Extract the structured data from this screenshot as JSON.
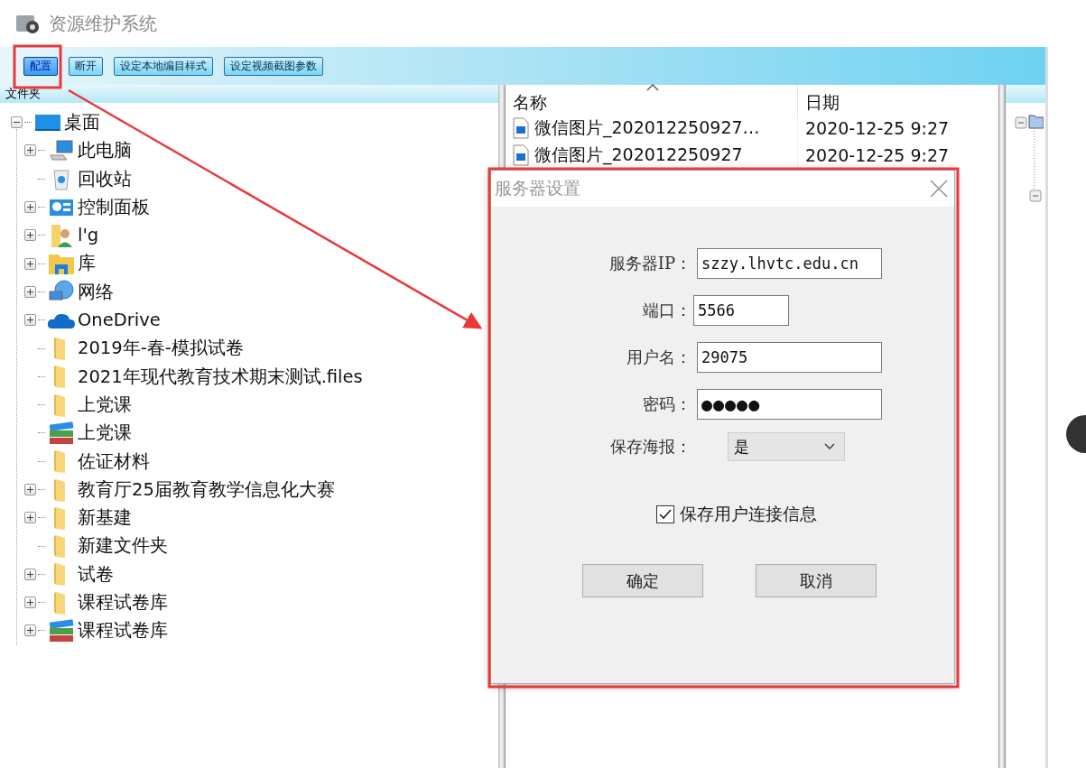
{
  "window": {
    "title": "资源维护系统"
  },
  "toolbar": [
    {
      "label": "配置",
      "selected": true
    },
    {
      "label": "断开",
      "selected": false
    },
    {
      "label": "设定本地编目样式",
      "selected": false
    },
    {
      "label": "设定视频截图参数",
      "selected": false
    }
  ],
  "folder_pane": {
    "title": "文件夹",
    "tree": [
      {
        "label": "桌面",
        "kind": "desktop",
        "expanded": true,
        "children": [
          {
            "label": "此电脑",
            "kind": "computer",
            "expanded": false
          },
          {
            "label": "回收站",
            "kind": "bin"
          },
          {
            "label": "控制面板",
            "kind": "panel",
            "expanded": false
          },
          {
            "label": "l'g",
            "kind": "user",
            "expanded": false
          },
          {
            "label": "库",
            "kind": "library",
            "expanded": false
          },
          {
            "label": "网络",
            "kind": "network",
            "expanded": false
          },
          {
            "label": "OneDrive",
            "kind": "cloud",
            "expanded": false
          },
          {
            "label": "2019年-春-模拟试卷",
            "kind": "folder"
          },
          {
            "label": "2021年现代教育技术期末测试.files",
            "kind": "folder"
          },
          {
            "label": "上党课",
            "kind": "folder"
          },
          {
            "label": "上党课",
            "kind": "archive"
          },
          {
            "label": "佐证材料",
            "kind": "folder"
          },
          {
            "label": "教育厅25届教育教学信息化大赛",
            "kind": "folder",
            "expanded": false
          },
          {
            "label": "新基建",
            "kind": "folder",
            "expanded": false
          },
          {
            "label": "新建文件夹",
            "kind": "folder"
          },
          {
            "label": "试卷",
            "kind": "folder",
            "expanded": false
          },
          {
            "label": "课程试卷库",
            "kind": "folder",
            "expanded": false
          },
          {
            "label": "课程试卷库",
            "kind": "archive",
            "expanded": false
          }
        ]
      }
    ]
  },
  "file_list": {
    "columns": [
      "名称",
      "日期"
    ],
    "rows": [
      {
        "name": "微信图片_202012250927…",
        "date": "2020-12-25 9:27"
      },
      {
        "name": "微信图片_202012250927",
        "date": "2020-12-25 9:27"
      }
    ]
  },
  "dialog": {
    "title": "服务器设置",
    "fields": [
      {
        "kind": "text",
        "label": "服务器IP：",
        "value": "szzy.lhvtc.edu.cn"
      },
      {
        "kind": "short",
        "label": "端口：",
        "value": "5566"
      },
      {
        "kind": "text",
        "label": "用户名：",
        "value": "29075"
      },
      {
        "kind": "password",
        "label": "密码：",
        "value": "●●●●●"
      },
      {
        "kind": "select",
        "label": "保存海报：",
        "value": "是"
      }
    ],
    "remember": {
      "label": "保存用户连接信息",
      "checked": true
    },
    "buttons": [
      "确定",
      "取消"
    ]
  }
}
